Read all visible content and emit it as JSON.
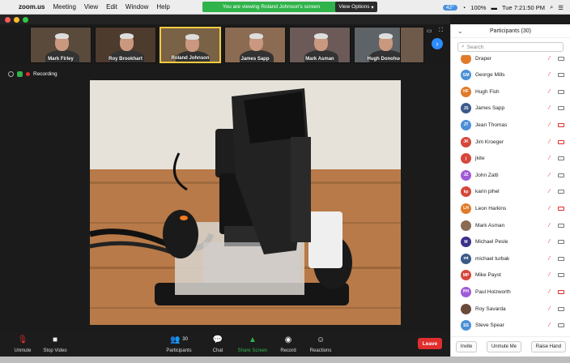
{
  "menubar": {
    "app": "zoom.us",
    "items": [
      "Meeting",
      "View",
      "Edit",
      "Window",
      "Help"
    ],
    "banner": "You are viewing Roland Johnson's screen",
    "view_options": "View Options",
    "battery": "100%",
    "clock": "Tue 7:21:50 PM",
    "temp": "42°"
  },
  "thumbnails": [
    {
      "name": "Mark Firley",
      "bg": "#5a4a3c"
    },
    {
      "name": "Roy Brookhart",
      "bg": "#4d3b2e"
    },
    {
      "name": "Roland Johnson",
      "bg": "#7a6247",
      "active": true
    },
    {
      "name": "James Sapp",
      "bg": "#8b6b52"
    },
    {
      "name": "Mark Asman",
      "bg": "#6b5a58"
    },
    {
      "name": "Hugh Donohue",
      "bg": "#5e6368"
    },
    {
      "name": "",
      "bg": "#6e5a4a"
    }
  ],
  "recording": "Recording",
  "toolbar": {
    "unmute": "Unmute",
    "stop_video": "Stop Video",
    "participants": "Participants",
    "participants_count": "30",
    "chat": "Chat",
    "share_screen": "Share Screen",
    "record": "Record",
    "reactions": "Reactions",
    "leave": "Leave"
  },
  "panel": {
    "title": "Participants (30)",
    "search_placeholder": "Search",
    "participants": [
      {
        "initials": "",
        "name": "Draper",
        "color": "#e07b2a",
        "video": true
      },
      {
        "initials": "GM",
        "name": "George Mills",
        "color": "#4a8fd6",
        "video": true
      },
      {
        "initials": "HF",
        "name": "Hugh Fish",
        "color": "#e07b2a",
        "video": true
      },
      {
        "initials": "JS",
        "name": "James Sapp",
        "color": "#3b5a8a",
        "video": true
      },
      {
        "initials": "JT",
        "name": "Jean Thomas",
        "color": "#4a8fd6",
        "video": false
      },
      {
        "initials": "JK",
        "name": "Jim Kroeger",
        "color": "#d6463a",
        "video": false
      },
      {
        "initials": "j",
        "name": "jkite",
        "color": "#d6463a",
        "video": true
      },
      {
        "initials": "JZ",
        "name": "John Zatti",
        "color": "#a05ad6",
        "video": true
      },
      {
        "initials": "kp",
        "name": "karin pihel",
        "color": "#d6463a",
        "video": true
      },
      {
        "initials": "LH",
        "name": "Leon Harkins",
        "color": "#e07b2a",
        "video": false
      },
      {
        "initials": "",
        "name": "Mark Asman",
        "color": "#8b6b52",
        "video": true
      },
      {
        "initials": "M",
        "name": "Michael Pesle",
        "color": "#3a2f8a",
        "video": true
      },
      {
        "initials": "mt",
        "name": "michael turbak",
        "color": "#3b5a8a",
        "video": true
      },
      {
        "initials": "MP",
        "name": "Mike Payst",
        "color": "#d6463a",
        "video": true
      },
      {
        "initials": "PH",
        "name": "Paul Holzworth",
        "color": "#a05ad6",
        "video": false
      },
      {
        "initials": "",
        "name": "Roy Savarda",
        "color": "#6a4a3a",
        "video": true
      },
      {
        "initials": "SS",
        "name": "Steve Spear",
        "color": "#4a8fd6",
        "video": true
      }
    ],
    "buttons": [
      "Invite",
      "Unmute Me",
      "Raise Hand"
    ]
  }
}
